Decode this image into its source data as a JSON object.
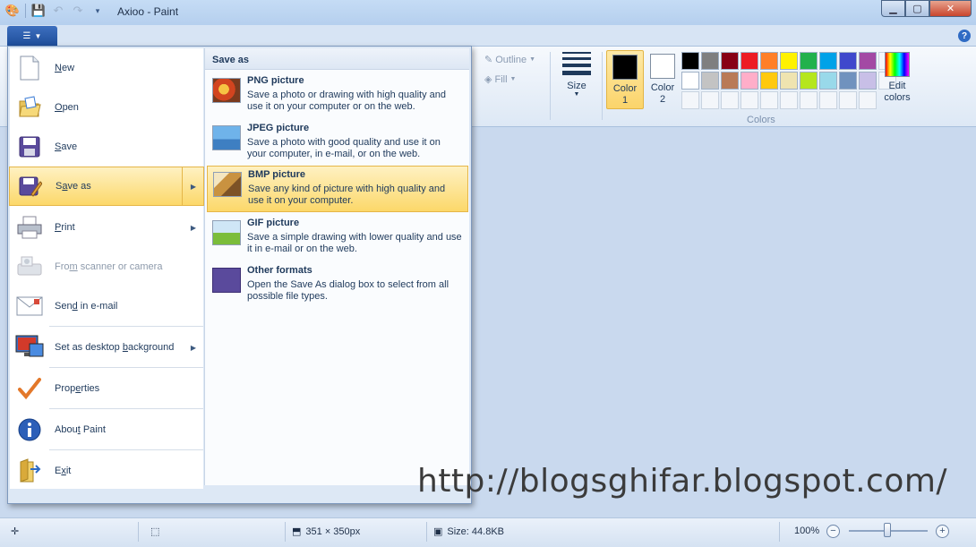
{
  "window": {
    "title": "Axioo - Paint"
  },
  "ribbon": {
    "outline_label": "Outline",
    "fill_label": "Fill",
    "size_label": "Size",
    "color1_label_a": "Color",
    "color1_label_b": "1",
    "color2_label_a": "Color",
    "color2_label_b": "2",
    "colors_group_label": "Colors",
    "edit_colors_label_a": "Edit",
    "edit_colors_label_b": "colors",
    "color1_value": "#000000",
    "color2_value": "#ffffff",
    "palette_row1": [
      "#000000",
      "#7f7f7f",
      "#880015",
      "#ed1c24",
      "#ff7f27",
      "#fff200",
      "#22b14c",
      "#00a2e8",
      "#3f48cc",
      "#a349a4"
    ],
    "palette_row2": [
      "#ffffff",
      "#c3c3c3",
      "#b97a57",
      "#ffaec9",
      "#ffc90e",
      "#efe4b0",
      "#b5e61d",
      "#99d9ea",
      "#7092be",
      "#c8bfe7"
    ]
  },
  "app_menu": {
    "items": [
      {
        "name": "new",
        "label": "New",
        "accel": "N",
        "icon": "new-document-icon"
      },
      {
        "name": "open",
        "label": "Open",
        "accel": "O",
        "icon": "open-folder-icon"
      },
      {
        "name": "save",
        "label": "Save",
        "accel": "S",
        "icon": "save-disk-icon"
      },
      {
        "name": "save-as",
        "label": "Save as",
        "accel": "a",
        "icon": "save-as-icon"
      },
      {
        "name": "print",
        "label": "Print",
        "accel": "P",
        "icon": "printer-icon"
      },
      {
        "name": "from-scanner",
        "label": "From scanner or camera",
        "accel": "m",
        "icon": "scanner-icon"
      },
      {
        "name": "send-email",
        "label": "Send in e-mail",
        "accel": "d",
        "icon": "email-icon"
      },
      {
        "name": "set-desktop-bg",
        "label": "Set as desktop background",
        "accel": "b",
        "icon": "desktop-icon"
      },
      {
        "name": "properties",
        "label": "Properties",
        "accel": "e",
        "icon": "checkmark-icon"
      },
      {
        "name": "about",
        "label": "About Paint",
        "accel": "t",
        "icon": "info-icon"
      },
      {
        "name": "exit",
        "label": "Exit",
        "accel": "x",
        "icon": "exit-icon"
      }
    ],
    "submenu": {
      "header": "Save as",
      "items": [
        {
          "title": "PNG picture",
          "desc": "Save a photo or drawing with high quality and use it on your computer or on the web."
        },
        {
          "title": "JPEG picture",
          "desc": "Save a photo with good quality and use it on your computer, in e-mail, or on the web."
        },
        {
          "title": "BMP picture",
          "desc": "Save any kind of picture with high quality and use it on your computer."
        },
        {
          "title": "GIF picture",
          "desc": "Save a simple drawing with lower quality and use it in e-mail or on the web."
        },
        {
          "title": "Other formats",
          "desc": "Open the Save As dialog box to select from all possible file types."
        }
      ]
    }
  },
  "status": {
    "dimensions": "351 × 350px",
    "size": "Size: 44.8KB",
    "zoom": "100%"
  },
  "watermark": "http://blogsghifar.blogspot.com/"
}
